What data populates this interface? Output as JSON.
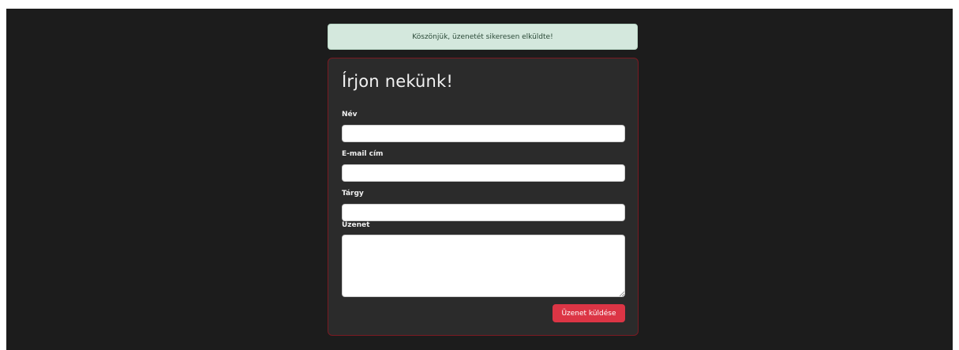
{
  "alert": {
    "message": "Köszönjük, üzenetét sikeresen elküldte!"
  },
  "form": {
    "title": "Írjon nekünk!",
    "fields": {
      "name": {
        "label": "Név",
        "value": "",
        "placeholder": ""
      },
      "email": {
        "label": "E-mail cím",
        "value": "",
        "placeholder": ""
      },
      "subject": {
        "label": "Tárgy",
        "value": "",
        "placeholder": ""
      },
      "message": {
        "label": "Üzenet",
        "value": "",
        "placeholder": ""
      }
    },
    "submit_label": "Üzenet küldése"
  },
  "colors": {
    "page_background": "#1c1c1c",
    "card_background": "#2b2b2b",
    "card_border": "#7a1a22",
    "alert_background": "#d4e8dd",
    "alert_text": "#2b4a38",
    "submit_button": "#dc3545"
  }
}
